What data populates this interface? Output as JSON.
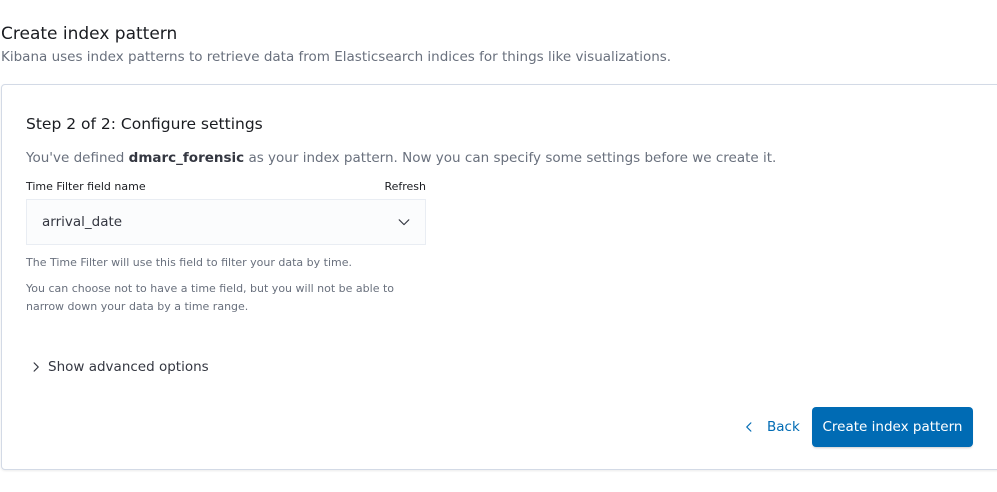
{
  "header": {
    "title": "Create index pattern",
    "subtitle": "Kibana uses index patterns to retrieve data from Elasticsearch indices for things like visualizations."
  },
  "step": {
    "title": "Step 2 of 2: Configure settings",
    "description_prefix": "You've defined ",
    "pattern_name": "dmarc_forensic",
    "description_suffix": " as your index pattern. Now you can specify some settings before we create it."
  },
  "time_filter": {
    "label": "Time Filter field name",
    "refresh_label": "Refresh",
    "selected_value": "arrival_date",
    "help_1": "The Time Filter will use this field to filter your data by time.",
    "help_2": "You can choose not to have a time field, but you will not be able to narrow down your data by a time range."
  },
  "advanced": {
    "label": "Show advanced options"
  },
  "actions": {
    "back_label": "Back",
    "create_label": "Create index pattern"
  },
  "colors": {
    "accent": "#006bb4",
    "title_text": "#1a1c21",
    "subdued_text": "#69707d",
    "border": "#d3dae6"
  },
  "icons": {
    "select": "chevron-down-icon",
    "advanced": "chevron-right-icon",
    "back": "chevron-left-icon"
  }
}
